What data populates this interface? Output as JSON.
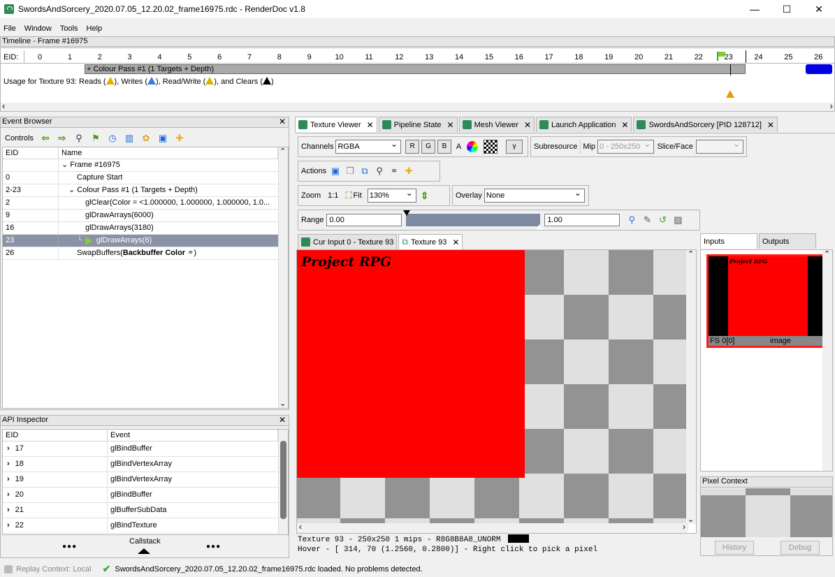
{
  "window": {
    "title": "SwordsAndSorcery_2020.07.05_12.20.02_frame16975.rdc - RenderDoc v1.8",
    "minimize": "—",
    "maximize": "☐",
    "close": "✕"
  },
  "menu": [
    "File",
    "Window",
    "Tools",
    "Help"
  ],
  "timeline": {
    "header": "Timeline - Frame #16975",
    "eid_label": "EID:",
    "ticks": [
      "0",
      "1",
      "2",
      "3",
      "4",
      "5",
      "6",
      "7",
      "8",
      "9",
      "10",
      "11",
      "12",
      "13",
      "14",
      "15",
      "16",
      "17",
      "18",
      "19",
      "20",
      "21",
      "22",
      "23",
      "24",
      "25",
      "26"
    ],
    "pass_label": "+ Colour Pass #1 (1 Targets + Depth)",
    "usage": {
      "prefix": "Usage for Texture 93: Reads (",
      "writes": "), Writes (",
      "rw": "), Read/Write (",
      "clears": "), and Clears (",
      "suffix": ")"
    }
  },
  "event_browser": {
    "header": "Event Browser",
    "controls_label": "Controls",
    "col_eid": "EID",
    "col_name": "Name",
    "rows": [
      {
        "eid": "",
        "name": "⌄ Frame #16975"
      },
      {
        "eid": "0",
        "name": "Capture Start"
      },
      {
        "eid": "2-23",
        "name": "⌄ Colour Pass #1 (1 Targets + Depth)"
      },
      {
        "eid": "2",
        "name": "glClear(Color = <1.000000, 1.000000, 1.000000, 1.0..."
      },
      {
        "eid": "9",
        "name": "glDrawArrays(6000)"
      },
      {
        "eid": "16",
        "name": "glDrawArrays(3180)"
      },
      {
        "eid": "23",
        "name": "glDrawArrays(6)"
      },
      {
        "eid": "26",
        "name": "SwapBuffers("
      }
    ],
    "swap_bold": "Backbuffer Color",
    "swap_end": ")"
  },
  "api_inspector": {
    "header": "API Inspector",
    "col_eid": "EID",
    "col_event": "Event",
    "rows": [
      {
        "eid": "17",
        "event": "glBindBuffer"
      },
      {
        "eid": "18",
        "event": "glBindVertexArray"
      },
      {
        "eid": "19",
        "event": "glBindVertexArray"
      },
      {
        "eid": "20",
        "event": "glBindBuffer"
      },
      {
        "eid": "21",
        "event": "glBufferSubData"
      },
      {
        "eid": "22",
        "event": "glBindTexture"
      }
    ],
    "callstack": "Callstack",
    "dots": "●●●"
  },
  "main_tabs": [
    "Texture Viewer",
    "Pipeline State",
    "Mesh Viewer",
    "Launch Application",
    "SwordsAndSorcery [PID 128712]"
  ],
  "texture_viewer": {
    "channels_label": "Channels",
    "channels_value": "RGBA",
    "ch_r": "R",
    "ch_g": "G",
    "ch_b": "B",
    "ch_a": "A",
    "gamma": "γ",
    "subresource_label": "Subresource",
    "mip_label": "Mip",
    "mip_value": "0 - 250x250",
    "slice_label": "Slice/Face",
    "actions_label": "Actions",
    "zoom_label": "Zoom",
    "zoom_11": "1:1",
    "fit_label": "Fit",
    "zoom_value": "130%",
    "overlay_label": "Overlay",
    "overlay_value": "None",
    "range_label": "Range",
    "range_min": "0.00",
    "range_max": "1.00",
    "sub_tabs": [
      "Cur Input 0 - Texture 93",
      "Texture 93"
    ],
    "texture_text": "Project RPG",
    "status1": "Texture 93 - 250x250 1 mips - R8G8B8A8_UNORM",
    "status2": "Hover - [ 314,   70 (1.2560, 0.2800)] - Right click to pick a pixel"
  },
  "side": {
    "tabs": [
      "Inputs",
      "Outputs"
    ],
    "thumb_slot": "FS 0[0]",
    "thumb_name": "image",
    "thumb_text": "Project RPG",
    "pixel_context": "Pixel Context",
    "history": "History",
    "debug": "Debug"
  },
  "statusbar": {
    "replay": "Replay Context: Local",
    "message": "SwordsAndSorcery_2020.07.05_12.20.02_frame16975.rdc loaded. No problems detected."
  }
}
